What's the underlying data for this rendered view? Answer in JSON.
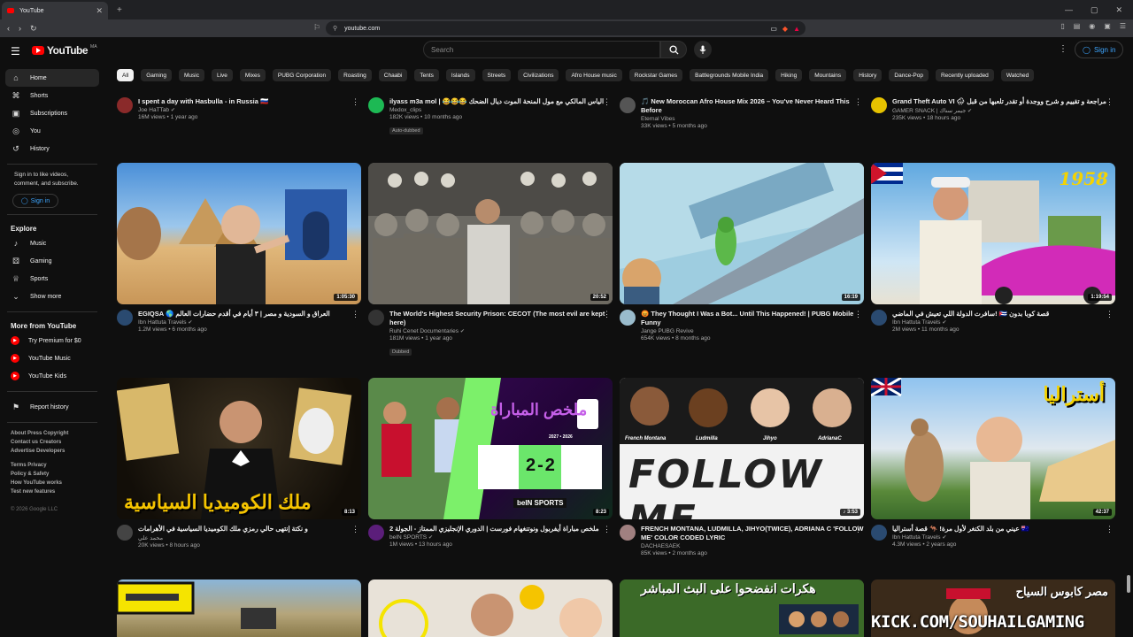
{
  "browser": {
    "tab_title": "YouTube",
    "url": "youtube.com"
  },
  "header": {
    "logo_text": "YouTube",
    "logo_country": "MA",
    "search_placeholder": "Search",
    "signin_label": "Sign in"
  },
  "sidebar": {
    "items": [
      {
        "label": "Home",
        "icon": "home-icon"
      },
      {
        "label": "Shorts",
        "icon": "shorts-icon"
      },
      {
        "label": "Subscriptions",
        "icon": "subscriptions-icon"
      },
      {
        "label": "You",
        "icon": "user-icon"
      },
      {
        "label": "History",
        "icon": "history-icon"
      }
    ],
    "signin_note": "Sign in to like videos, comment, and subscribe.",
    "signin_label": "Sign in",
    "explore_title": "Explore",
    "explore": [
      {
        "label": "Music",
        "icon": "music-icon"
      },
      {
        "label": "Gaming",
        "icon": "gaming-icon"
      },
      {
        "label": "Sports",
        "icon": "trophy-icon"
      },
      {
        "label": "Show more",
        "icon": "chevron-down-icon"
      }
    ],
    "more_title": "More from YouTube",
    "more": [
      {
        "label": "Try Premium for $0"
      },
      {
        "label": "YouTube Music"
      },
      {
        "label": "YouTube Kids"
      }
    ],
    "report": "Report history",
    "footer1": "About  Press  Copyright",
    "footer2": "Contact us  Creators",
    "footer3": "Advertise  Developers",
    "footer4": "Terms  Privacy",
    "footer5": "Policy & Safety",
    "footer6": "How YouTube works",
    "footer7": "Test new features",
    "copyright": "© 2026 Google LLC"
  },
  "chips": [
    "All",
    "Gaming",
    "Music",
    "Live",
    "Mixes",
    "PUBG Corporation",
    "Roasting",
    "Chaabi",
    "Tents",
    "Islands",
    "Streets",
    "Civilizations",
    "Afro House music",
    "Rockstar Games",
    "Battlegrounds Mobile India",
    "Hiking",
    "Mountains",
    "History",
    "Dance-Pop",
    "Recently uploaded",
    "Watched"
  ],
  "top_row": [
    {
      "title": "I spent a day with Hasbulla - in Russia 🇷🇺",
      "channel": "Joe HaTTab",
      "stats": "16M views • 1 year ago",
      "badge": ""
    },
    {
      "title": "ilyass m3a mol | 😂😂😂 الياس المالكي مع مول المنحة الموت ديال الضحك",
      "channel": "Medox_clips",
      "stats": "182K views • 10 months ago",
      "badge": "Auto-dubbed"
    },
    {
      "title": "🎵 New Moroccan Afro House Mix 2026 – You've Never Heard This Before",
      "channel": "Eternal Vibes",
      "stats": "33K views • 5 months ago",
      "badge": ""
    },
    {
      "title": "Grand Theft Auto VI 🌧 مراجعة و تقييم و شرح ووجدة أو تقدر تلعبها من قبل",
      "channel": "GAMER SNACK | جيمر سناك",
      "stats": "235K views • 18 hours ago",
      "badge": ""
    }
  ],
  "row2": [
    {
      "title": "EGIQSA 🌎 العراق و السودية و مصر | ٣ أيام في أقدم حضارات العالم",
      "channel": "Ibn Hattuta Travels",
      "stats": "1.2M views • 6 months ago",
      "duration": "1:05:30",
      "badge": ""
    },
    {
      "title": "The World's Highest Security Prison: CECOT (The most evil are kept here)",
      "channel": "Ruhi Cenet Documentaries",
      "stats": "181M views • 1 year ago",
      "duration": "20:52",
      "badge": "Dubbed"
    },
    {
      "title": "😡 They Thought I Was a Bot... Until This Happened! | PUBG Mobile Funny",
      "channel": "Jange PUBG Revive",
      "stats": "654K views • 8 months ago",
      "duration": "16:19",
      "badge": ""
    },
    {
      "title": "سافرت الدولة اللي تعيش في الماضي! 🇨🇺 قصة كوبا بدون",
      "channel": "Ibn Hattuta Travels",
      "stats": "2M views • 11 months ago",
      "duration": "1:19:54",
      "badge": ""
    }
  ],
  "row3": [
    {
      "title": "و نكتة إنتهى حالي رمزي ملك الكوميديا السياسية في الأهرامات",
      "channel": "محمد علي",
      "stats": "20K views • 8 hours ago",
      "duration": "8:13",
      "badge": ""
    },
    {
      "title": "ملخص مباراة  أيفربول ونوتنغهام فورست | الدوري الإنجليزي الممتاز - الجولة 2",
      "channel": "beIN SPORTS",
      "stats": "1M views • 13 hours ago",
      "duration": "8:23",
      "badge": ""
    },
    {
      "title": "FRENCH MONTANA, LUDMILLA, JIHYO(TWICE), ADRIANA C 'FOLLOW ME' COLOR CODED LYRIC",
      "channel": "DACHAESAEK",
      "stats": "85K views • 2 months ago",
      "duration": "3:53",
      "badge": ""
    },
    {
      "title": "عيني من بلد الكنغر لأول مرة! 🦘 قصة أستراليا 🇦🇺",
      "channel": "Ibn Hattuta Travels",
      "stats": "4.3M views • 2 years ago",
      "duration": "42:37",
      "badge": ""
    }
  ],
  "thumb_text": {
    "comedy": "ملك الكوميديا السياسية",
    "match": "ملخص المباراة",
    "score": "2-2",
    "season": "2027 • 2026",
    "bein": "beIN SPORTS",
    "follow": "FOLLOW ME",
    "names": [
      "French Montana",
      "Ludmilla",
      "Jihyo",
      "AdrianaC"
    ],
    "australia": "أستراليا",
    "year": "1958",
    "hackers": "هكرات انفضحوا على البث المباشر",
    "egypt": "مصر كابوس السياح"
  },
  "watermark": "KICK.COM/SOUHAILGAMING",
  "colors": {
    "accent": "#3ea6ff",
    "brand": "#ff0000",
    "background": "#0f0f0f"
  }
}
